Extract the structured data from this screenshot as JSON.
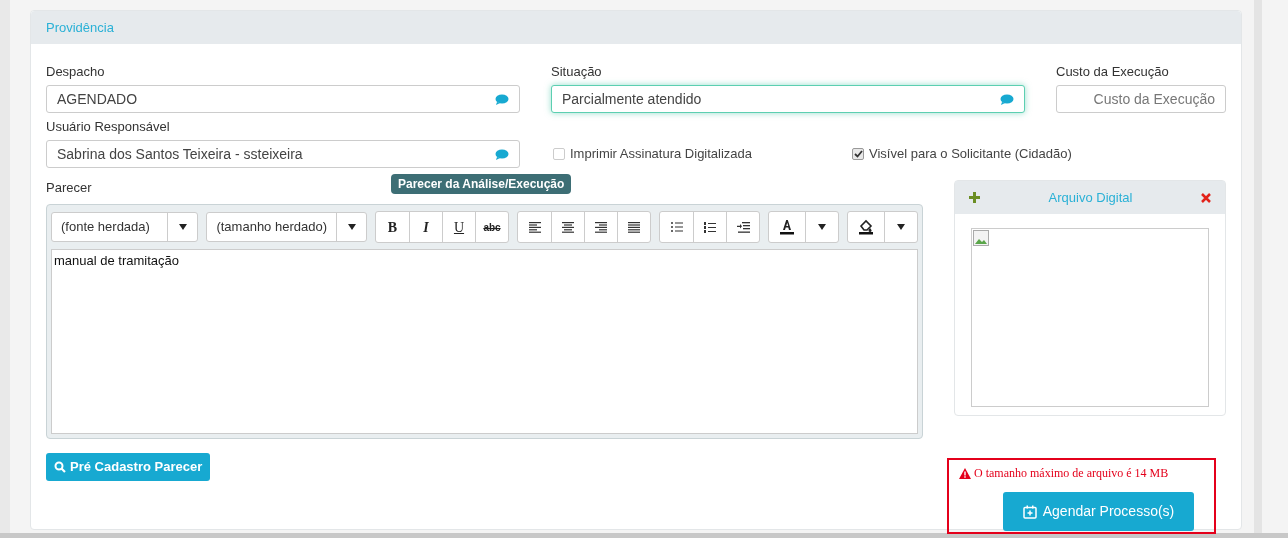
{
  "panel": {
    "title": "Providência"
  },
  "fields": [
    {
      "label": "Despacho",
      "value": "AGENDADO",
      "kind": "select",
      "focused": false
    },
    {
      "label": "Situação",
      "value": "Parcialmente atendido",
      "kind": "select",
      "focused": true
    },
    {
      "label": "Custo da Execução",
      "placeholder": "Custo da Execução",
      "kind": "text",
      "focused": false
    },
    {
      "label": "Usuário Responsável",
      "value": "Sabrina dos Santos Teixeira - ssteixeira",
      "kind": "select",
      "focused": false
    }
  ],
  "checkboxes": [
    {
      "label": "Imprimir Assinatura Digitalizada",
      "checked": false
    },
    {
      "label": "Visível para o Solicitante (Cidadão)",
      "checked": true
    }
  ],
  "editor": {
    "label": "Parecer",
    "tooltip": "Parecer da Análise/Execução",
    "font_select": "(fonte herdada)",
    "size_select": "(tamanho herdado)",
    "format_buttons": [
      {
        "label": "B",
        "kind": "bold"
      },
      {
        "label": "I",
        "kind": "italic"
      },
      {
        "label": "U",
        "kind": "underline"
      },
      {
        "label": "abc",
        "kind": "strike"
      }
    ],
    "content": "manual de tramitação"
  },
  "attachments": {
    "title": "Arquivo Digital"
  },
  "pre_cadastro_button": "Pré Cadastro Parecer",
  "warning": "O tamanho máximo de arquivo é 14 MB",
  "submit_button": "Agendar Processo(s)"
}
